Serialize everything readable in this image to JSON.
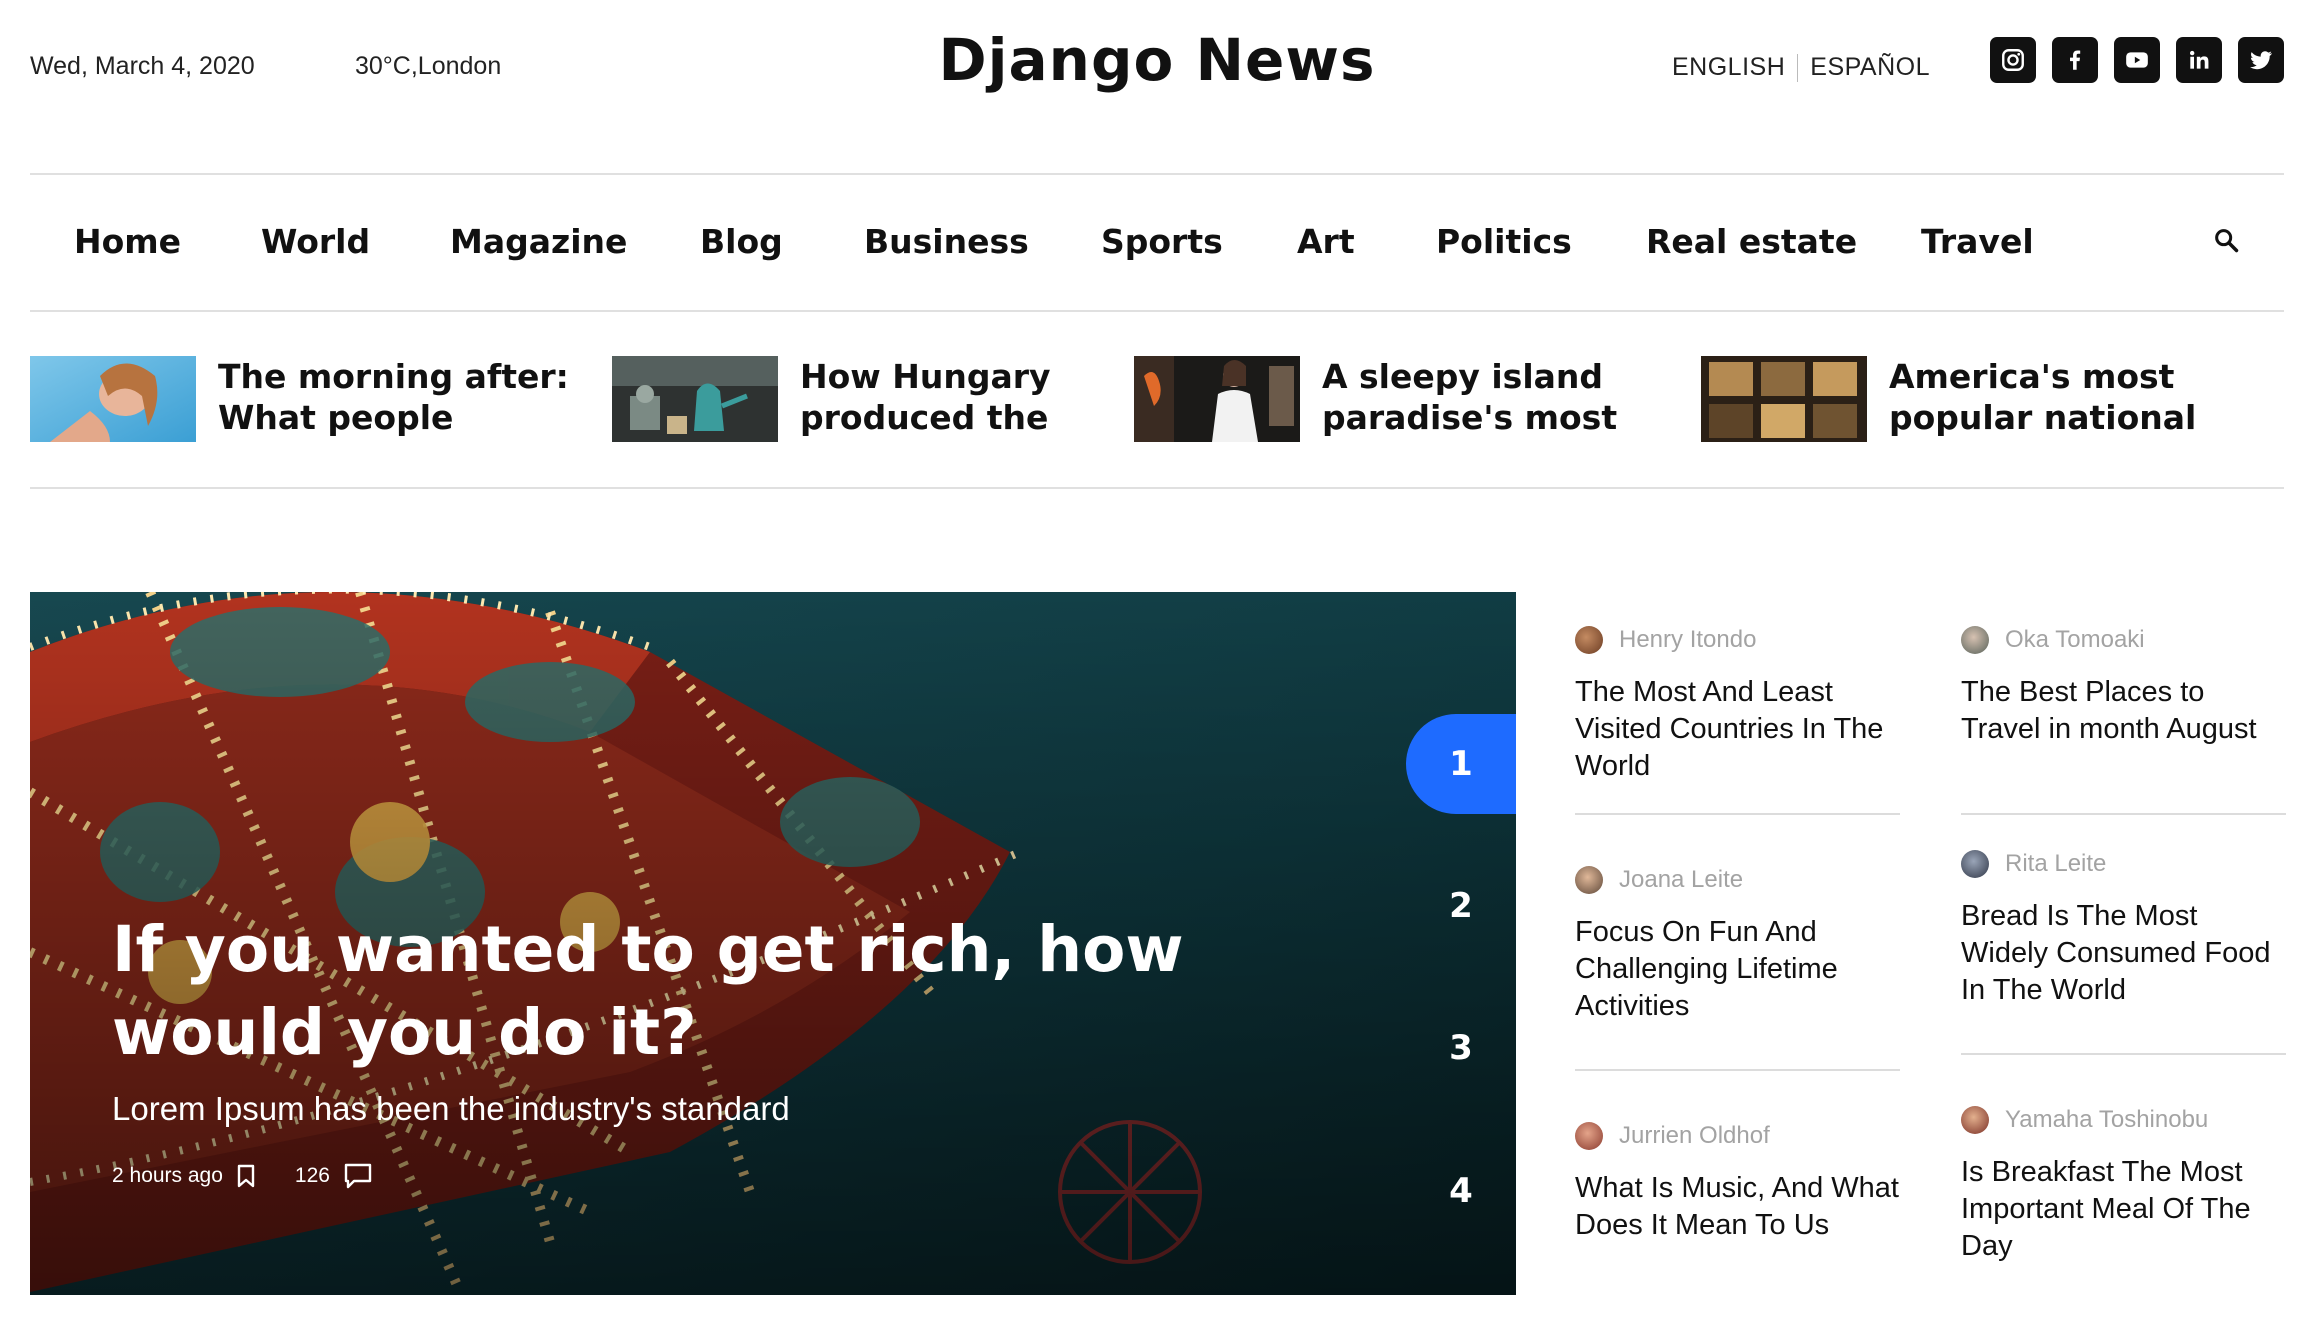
{
  "header": {
    "date": "Wed, March 4, 2020",
    "weather": "30°C,London",
    "logo": "Django News",
    "languages": [
      "ENGLISH",
      "ESPAÑOL"
    ],
    "socials": [
      "instagram-icon",
      "facebook-icon",
      "youtube-icon",
      "linkedin-icon",
      "twitter-icon"
    ]
  },
  "nav": {
    "items": [
      "Home",
      "World",
      "Magazine",
      "Blog",
      "Business",
      "Sports",
      "Art",
      "Politics",
      "Real estate",
      "Travel"
    ],
    "search_icon": "search-icon"
  },
  "trending": [
    {
      "title": "The morning after: What people"
    },
    {
      "title": "How Hungary produced the"
    },
    {
      "title": "A sleepy island paradise's most"
    },
    {
      "title": "America's most popular national"
    }
  ],
  "hero": {
    "title": "If you wanted to get rich, how would you do it?",
    "subtitle": "Lorem Ipsum has been the industry's standard",
    "time": "2 hours ago",
    "comments": "126",
    "pages": [
      "1",
      "2",
      "3",
      "4"
    ],
    "active_page": "1"
  },
  "side_articles": {
    "col1": [
      {
        "author": "Henry Itondo",
        "title": "The Most And Least Visited Countries In The World"
      },
      {
        "author": "Joana Leite",
        "title": "Focus On Fun And Challenging Lifetime Activities"
      },
      {
        "author": "Jurrien Oldhof",
        "title": "What Is Music, And What Does It Mean To Us"
      }
    ],
    "col2": [
      {
        "author": "Oka Tomoaki",
        "title": "The Best Places to Travel in month August"
      },
      {
        "author": "Rita Leite",
        "title": "Bread Is The Most Widely Consumed Food In The World"
      },
      {
        "author": "Yamaha Toshinobu",
        "title": "Is Breakfast The Most Important Meal Of The Day"
      }
    ]
  },
  "colors": {
    "accent": "#1e6bff",
    "text": "#111111",
    "muted": "#a3a3a3",
    "rule": "#e0e0e0"
  }
}
